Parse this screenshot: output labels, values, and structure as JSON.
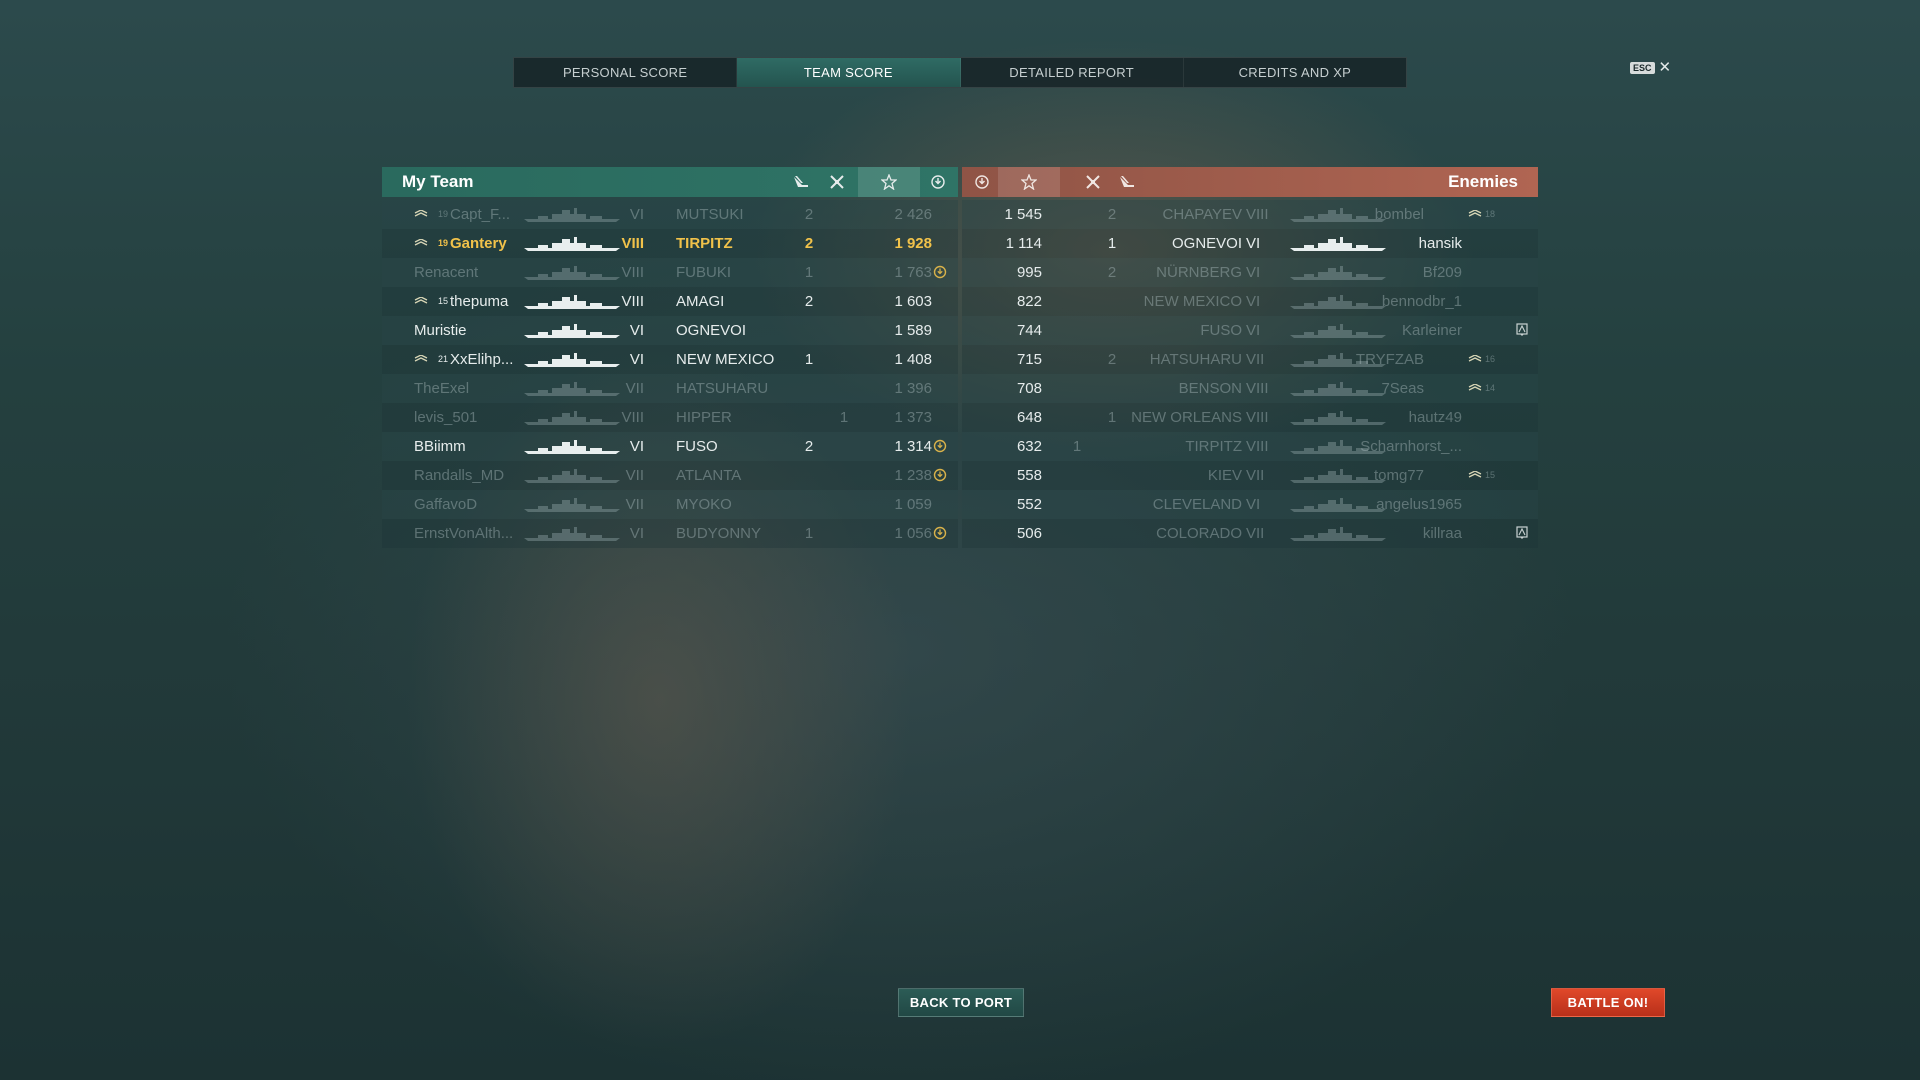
{
  "tabs": [
    {
      "label": "PERSONAL SCORE",
      "active": false
    },
    {
      "label": "TEAM SCORE",
      "active": true
    },
    {
      "label": "DETAILED REPORT",
      "active": false
    },
    {
      "label": "CREDITS AND XP",
      "active": false
    }
  ],
  "esc_key": "ESC",
  "close_glyph": "✕",
  "my_team": {
    "title": "My Team",
    "header_icons": [
      "ship-kills-icon",
      "planes-destroyed-icon",
      "score-star-icon",
      "base-capture-icon"
    ],
    "rows": [
      {
        "rank_num": "19",
        "name": "Capt_F...",
        "tier": "VI",
        "ship": "MUTSUKI",
        "kills": "2",
        "planes": "",
        "score": "2 426",
        "cap": false,
        "dead": true,
        "self": false
      },
      {
        "rank_num": "19",
        "name": "Gantery",
        "tier": "VIII",
        "ship": "TIRPITZ",
        "kills": "2",
        "planes": "",
        "score": "1 928",
        "cap": false,
        "dead": false,
        "self": true
      },
      {
        "rank_num": "",
        "name": "Renacent",
        "tier": "VIII",
        "ship": "FUBUKI",
        "kills": "1",
        "planes": "",
        "score": "1 763",
        "cap": true,
        "dead": true,
        "self": false
      },
      {
        "rank_num": "15",
        "name": "thepuma",
        "tier": "VIII",
        "ship": "AMAGI",
        "kills": "2",
        "planes": "",
        "score": "1 603",
        "cap": false,
        "dead": false,
        "self": false
      },
      {
        "rank_num": "",
        "name": "Muristie",
        "tier": "VI",
        "ship": "OGNEVOI",
        "kills": "",
        "planes": "",
        "score": "1 589",
        "cap": false,
        "dead": false,
        "self": false
      },
      {
        "rank_num": "21",
        "name": "XxElihp...",
        "tier": "VI",
        "ship": "NEW MEXICO",
        "kills": "1",
        "planes": "",
        "score": "1 408",
        "cap": false,
        "dead": false,
        "self": false
      },
      {
        "rank_num": "",
        "name": "TheExel",
        "tier": "VII",
        "ship": "HATSUHARU",
        "kills": "",
        "planes": "",
        "score": "1 396",
        "cap": false,
        "dead": true,
        "self": false
      },
      {
        "rank_num": "",
        "name": "levis_501",
        "tier": "VIII",
        "ship": "HIPPER",
        "kills": "",
        "planes": "1",
        "score": "1 373",
        "cap": false,
        "dead": true,
        "self": false
      },
      {
        "rank_num": "",
        "name": "BBiimm",
        "tier": "VI",
        "ship": "FUSO",
        "kills": "2",
        "planes": "",
        "score": "1 314",
        "cap": true,
        "dead": false,
        "self": false
      },
      {
        "rank_num": "",
        "name": "Randalls_MD",
        "tier": "VII",
        "ship": "ATLANTA",
        "kills": "",
        "planes": "",
        "score": "1 238",
        "cap": true,
        "dead": true,
        "self": false
      },
      {
        "rank_num": "",
        "name": "GaffavoD",
        "tier": "VII",
        "ship": "MYOKO",
        "kills": "",
        "planes": "",
        "score": "1 059",
        "cap": false,
        "dead": true,
        "self": false
      },
      {
        "rank_num": "",
        "name": "ErnstVonAlth...",
        "tier": "VI",
        "ship": "BUDYONNY",
        "kills": "1",
        "planes": "",
        "score": "1 056",
        "cap": true,
        "dead": true,
        "self": false
      }
    ]
  },
  "enemies": {
    "title": "Enemies",
    "header_icons": [
      "base-capture-icon",
      "score-star-icon",
      "planes-destroyed-icon",
      "ship-kills-icon"
    ],
    "rows": [
      {
        "score": "1 545",
        "planes": "",
        "kills": "2",
        "ship": "CHAPAYEV",
        "tier": "VIII",
        "name": "bombel",
        "rank_num": "18",
        "flag": false,
        "dead": true
      },
      {
        "score": "1 114",
        "planes": "",
        "kills": "1",
        "ship": "OGNEVOI",
        "tier": "VI",
        "name": "hansik",
        "rank_num": "",
        "flag": false,
        "dead": false
      },
      {
        "score": "995",
        "planes": "",
        "kills": "2",
        "ship": "NÜRNBERG",
        "tier": "VI",
        "name": "Bf209",
        "rank_num": "",
        "flag": false,
        "dead": true
      },
      {
        "score": "822",
        "planes": "",
        "kills": "",
        "ship": "NEW MEXICO",
        "tier": "VI",
        "name": "bennodbr_1",
        "rank_num": "",
        "flag": false,
        "dead": true
      },
      {
        "score": "744",
        "planes": "",
        "kills": "",
        "ship": "FUSO",
        "tier": "VI",
        "name": "Karleiner",
        "rank_num": "",
        "flag": true,
        "dead": true
      },
      {
        "score": "715",
        "planes": "",
        "kills": "2",
        "ship": "HATSUHARU",
        "tier": "VII",
        "name": "TRYFZAB",
        "rank_num": "16",
        "flag": false,
        "dead": true
      },
      {
        "score": "708",
        "planes": "",
        "kills": "",
        "ship": "BENSON",
        "tier": "VIII",
        "name": "7Seas",
        "rank_num": "14",
        "flag": false,
        "dead": true
      },
      {
        "score": "648",
        "planes": "",
        "kills": "1",
        "ship": "NEW ORLEANS",
        "tier": "VIII",
        "name": "hautz49",
        "rank_num": "",
        "flag": false,
        "dead": true
      },
      {
        "score": "632",
        "planes": "1",
        "kills": "",
        "ship": "TIRPITZ",
        "tier": "VIII",
        "name": "Scharnhorst_...",
        "rank_num": "",
        "flag": false,
        "dead": true
      },
      {
        "score": "558",
        "planes": "",
        "kills": "",
        "ship": "KIEV",
        "tier": "VII",
        "name": "tomg77",
        "rank_num": "15",
        "flag": false,
        "dead": true
      },
      {
        "score": "552",
        "planes": "",
        "kills": "",
        "ship": "CLEVELAND",
        "tier": "VI",
        "name": "angelus1965",
        "rank_num": "",
        "flag": false,
        "dead": true
      },
      {
        "score": "506",
        "planes": "",
        "kills": "",
        "ship": "COLORADO",
        "tier": "VII",
        "name": "killraa",
        "rank_num": "",
        "flag": true,
        "dead": true
      }
    ]
  },
  "buttons": {
    "back_to_port": "BACK TO PORT",
    "battle_on": "BATTLE ON!"
  },
  "colors": {
    "my_team_header": "#2f7466",
    "enemy_header": "#b06552",
    "self_highlight": "#f1c24a",
    "battle_button": "#d63b22"
  }
}
